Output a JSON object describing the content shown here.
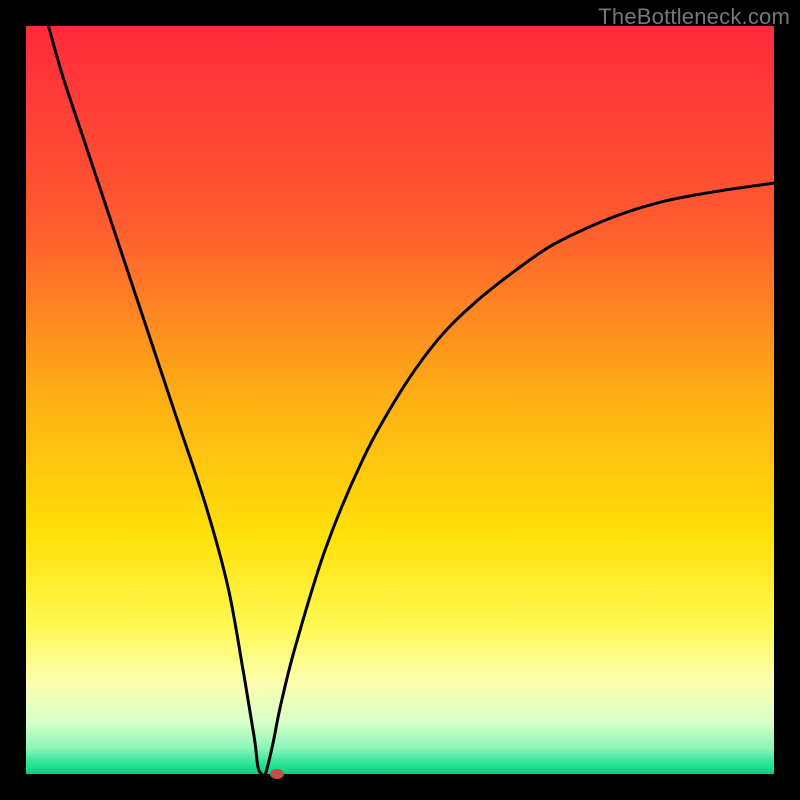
{
  "watermark": "TheBottleneck.com",
  "chart_data": {
    "type": "line",
    "title": "",
    "xlabel": "",
    "ylabel": "",
    "xlim": [
      0,
      100
    ],
    "ylim": [
      0,
      100
    ],
    "series": [
      {
        "name": "bottleneck-curve",
        "x": [
          3,
          5,
          8,
          12,
          16,
          20,
          24,
          27,
          29,
          30.5,
          31,
          31.5,
          32,
          33,
          34,
          36,
          40,
          45,
          50,
          55,
          60,
          65,
          70,
          75,
          80,
          85,
          90,
          95,
          100
        ],
        "y": [
          100,
          93,
          84,
          72,
          60,
          48,
          36,
          25,
          14,
          5,
          1,
          0,
          0,
          4,
          9,
          17,
          30,
          42,
          51,
          58,
          63,
          67,
          70.5,
          73,
          75,
          76.5,
          77.5,
          78.3,
          79
        ]
      }
    ],
    "marker": {
      "x": 33.5,
      "y": 0
    },
    "gradient_stops": [
      {
        "pct": 0,
        "color": "#ff2a3c"
      },
      {
        "pct": 26,
        "color": "#ff5a30"
      },
      {
        "pct": 50,
        "color": "#ffb015"
      },
      {
        "pct": 68,
        "color": "#ffe008"
      },
      {
        "pct": 80,
        "color": "#fff850"
      },
      {
        "pct": 88,
        "color": "#fbffb0"
      },
      {
        "pct": 93,
        "color": "#d8ffc8"
      },
      {
        "pct": 96.5,
        "color": "#8cf5b8"
      },
      {
        "pct": 98.5,
        "color": "#2fe598"
      },
      {
        "pct": 100,
        "color": "#08cf80"
      }
    ]
  }
}
